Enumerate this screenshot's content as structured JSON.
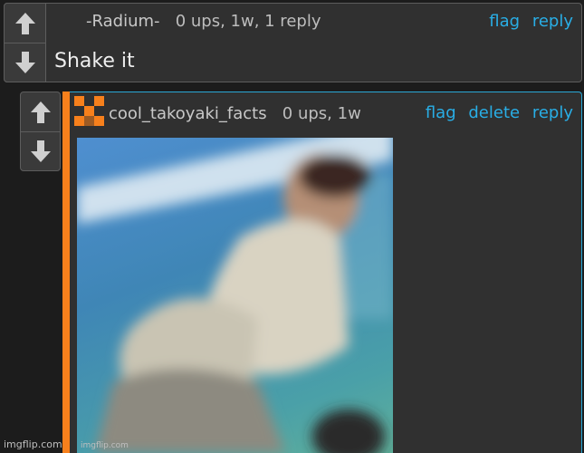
{
  "comment1": {
    "author": "-Radium-",
    "meta": "0 ups, 1w, 1 reply",
    "text": "Shake it",
    "links": {
      "flag": "flag",
      "reply": "reply"
    }
  },
  "comment2": {
    "author": "cool_takoyaki_facts",
    "meta": "0 ups, 1w",
    "links": {
      "flag": "flag",
      "delete": "delete",
      "reply": "reply"
    },
    "image_watermark": "imgflip.com"
  },
  "page_watermark": "imgflip.com",
  "colors": {
    "link": "#29aee6",
    "accent": "#f7801c",
    "reply_border": "#2aa8d6",
    "panel": "#303030"
  },
  "icons": [
    "upvote-arrow-icon",
    "downvote-arrow-icon",
    "user-avatar-icon"
  ]
}
